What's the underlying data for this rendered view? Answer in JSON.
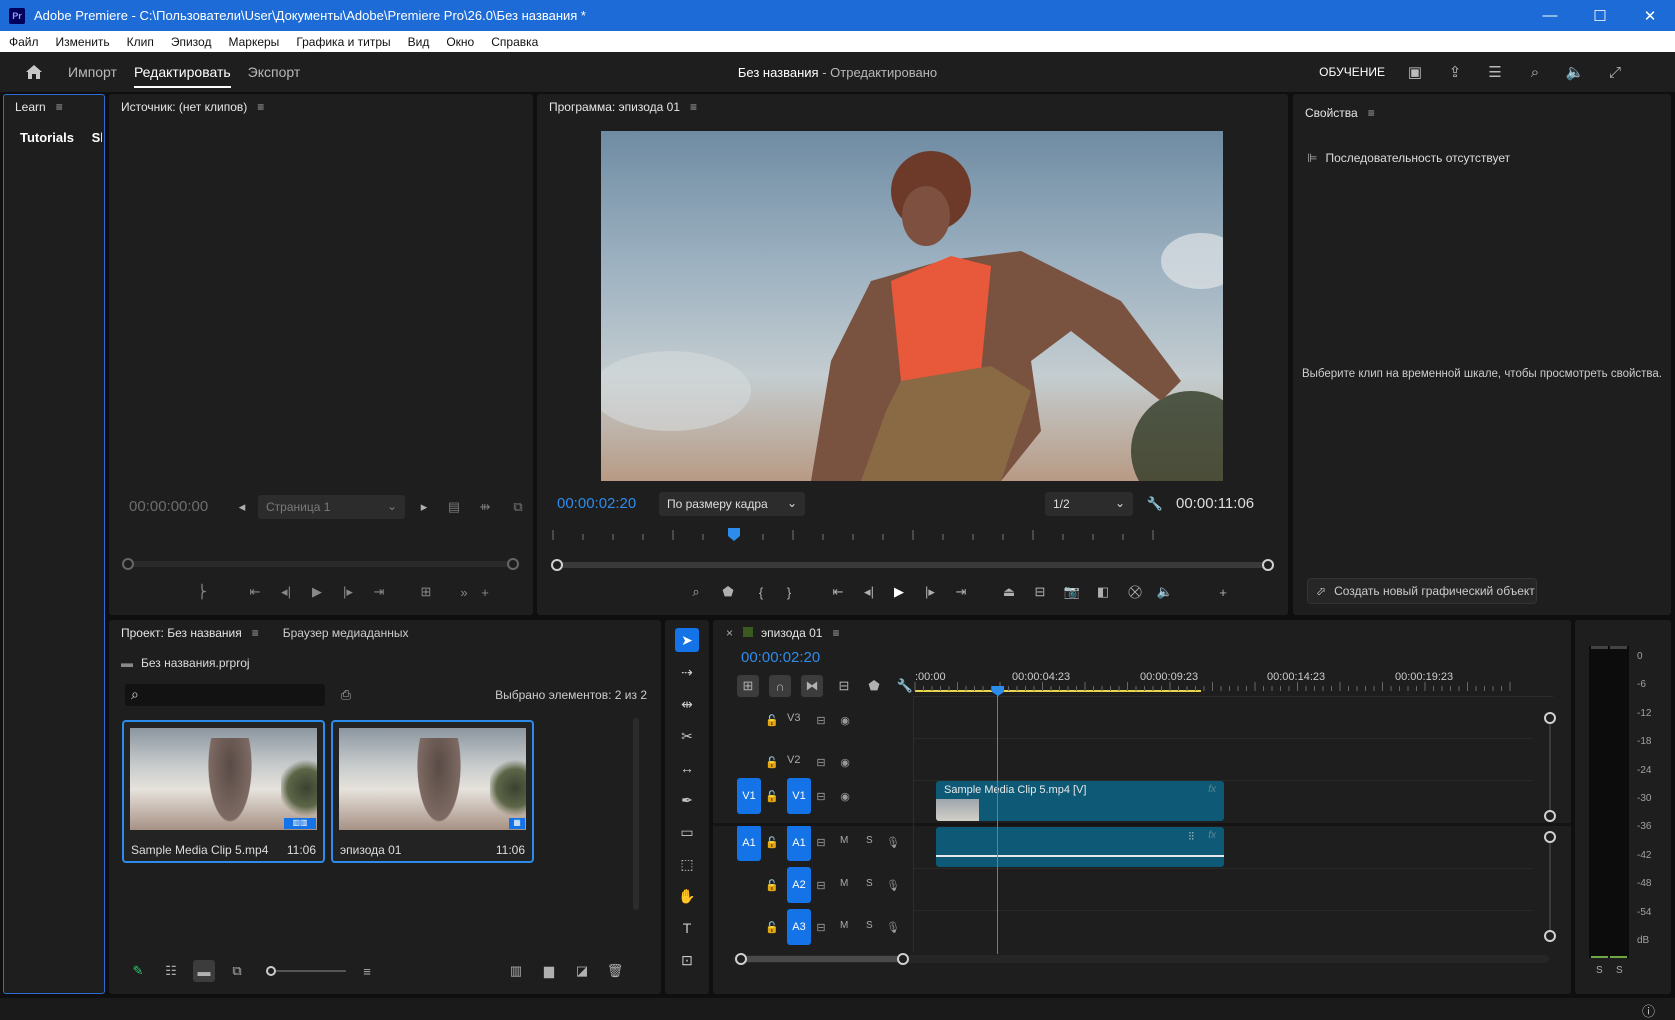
{
  "window": {
    "title": "Adobe Premiere - C:\\Пользователи\\User\\Документы\\Adobe\\Premiere Pro\\26.0\\Без названия *",
    "icon_text": "Pr",
    "minimize": "—",
    "maximize": "☐",
    "close": "✕"
  },
  "menu": [
    "Файл",
    "Изменить",
    "Клип",
    "Эпизод",
    "Маркеры",
    "Графика и титры",
    "Вид",
    "Окно",
    "Справка"
  ],
  "header": {
    "modes": [
      "Импорт",
      "Редактировать",
      "Экспорт"
    ],
    "doc_title": "Без названия",
    "doc_status": " - Отредактировано",
    "learn_label": "ОБУЧЕНИЕ"
  },
  "learn": {
    "title": "Learn",
    "tab1": "Tutorials",
    "tab2": "Sk"
  },
  "source": {
    "title": "Источник: (нет клипов)",
    "timecode": "00:00:00:00",
    "page": "Страница 1"
  },
  "program": {
    "title": "Программа: эпизода 01",
    "timecode": "00:00:02:20",
    "fit": "По размеру кадра",
    "resolution": "1/2",
    "duration": "00:00:11:06"
  },
  "properties": {
    "title": "Свойства",
    "no_sequence": "Последовательность отсутствует",
    "hint": "Выберите клип на временной шкале, чтобы просмотреть свойства.",
    "create_graphic": "Создать новый графический объект"
  },
  "project": {
    "tab1": "Проект: Без названия",
    "tab2": "Браузер медиаданных",
    "file": "Без названия.prproj",
    "selected": "Выбрано элементов: 2 из 2",
    "search_placeholder": "",
    "items": [
      {
        "name": "Sample Media Clip 5.mp4",
        "duration": "11:06"
      },
      {
        "name": "эпизода 01",
        "duration": "11:06"
      }
    ]
  },
  "timeline": {
    "close": "×",
    "title": "эпизода 01",
    "timecode": "00:00:02:20",
    "ruler": [
      ":00:00",
      "00:00:04:23",
      "00:00:09:23",
      "00:00:14:23",
      "00:00:19:23"
    ],
    "tracks": {
      "v3": "V3",
      "v2": "V2",
      "v1": "V1",
      "a1": "A1",
      "a2": "A2",
      "a3": "A3",
      "m": "M",
      "s": "S"
    },
    "clip_label": "Sample Media Clip 5.mp4 [V]",
    "fx": "fx"
  },
  "meter": {
    "labels": [
      "0",
      "-6",
      "-12",
      "-18",
      "-24",
      "-30",
      "-36",
      "-42",
      "-48",
      "-54",
      "dB"
    ],
    "solo": [
      "S",
      "S"
    ]
  },
  "colors": {
    "accent": "#2d8ceb",
    "titlebar": "#1c6bd6",
    "clip": "#0e5a76",
    "track_button": "#1473e6",
    "work_area": "#e8d44d"
  }
}
